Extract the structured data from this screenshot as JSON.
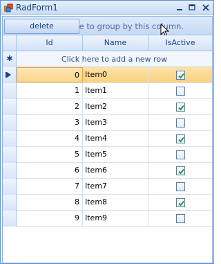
{
  "window": {
    "title": "RadForm1"
  },
  "toolbar": {
    "delete_label": "delete"
  },
  "group_panel": {
    "hint": "Drag a column here to group by this column."
  },
  "columns": [
    {
      "label": "Id"
    },
    {
      "label": "Name"
    },
    {
      "label": "IsActive"
    }
  ],
  "new_row": {
    "text": "Click here to add a new row"
  },
  "rows": [
    {
      "id": "0",
      "name": "Item0",
      "active": true
    },
    {
      "id": "1",
      "name": "Item1",
      "active": false
    },
    {
      "id": "2",
      "name": "Item2",
      "active": true
    },
    {
      "id": "3",
      "name": "Item3",
      "active": false
    },
    {
      "id": "4",
      "name": "Item4",
      "active": true
    },
    {
      "id": "5",
      "name": "Item5",
      "active": false
    },
    {
      "id": "6",
      "name": "Item6",
      "active": true
    },
    {
      "id": "7",
      "name": "Item7",
      "active": false
    },
    {
      "id": "8",
      "name": "Item8",
      "active": true
    },
    {
      "id": "9",
      "name": "Item9",
      "active": false
    }
  ],
  "current_row_index": 0,
  "colors": {
    "accent": "#15428b",
    "current_row": "#fbd17e",
    "check": "#2f9a2f"
  }
}
